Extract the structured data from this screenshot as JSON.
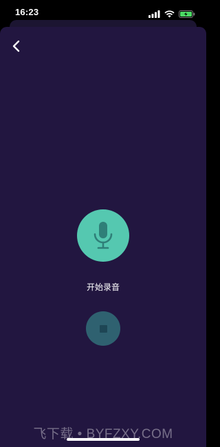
{
  "status_bar": {
    "time": "16:23",
    "battery_color": "#4cd964"
  },
  "nav": {
    "back_icon": "chevron-left-icon"
  },
  "recorder": {
    "record_icon": "microphone-icon",
    "record_color": "#55c8b0",
    "start_label": "开始录音",
    "stop_icon": "stop-icon",
    "stop_color": "#2f6170"
  },
  "watermark": {
    "text": "飞下载 • BYFZXY.COM"
  },
  "colors": {
    "background": "#221640"
  }
}
